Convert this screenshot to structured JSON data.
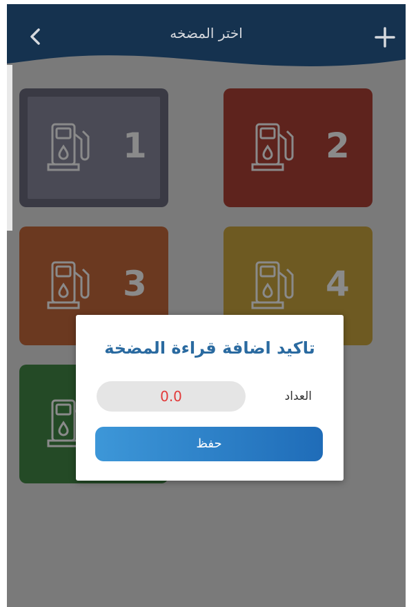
{
  "header": {
    "title": "اختر المضخه",
    "back_icon": "chevron-left-icon",
    "add_icon": "plus-icon"
  },
  "pumps": [
    {
      "number": "1",
      "color": "#3a3a44"
    },
    {
      "number": "2",
      "color": "#5e231d"
    },
    {
      "number": "3",
      "color": "#6b3920"
    },
    {
      "number": "4",
      "color": "#6e5a22"
    },
    {
      "number": "",
      "color": "#244a26"
    }
  ],
  "dialog": {
    "title": "تاكيد اضافة قراءة المضخة",
    "meter_label": "العداد",
    "meter_value": "0.0",
    "save_label": "حفظ"
  },
  "colors": {
    "header": "#15324f",
    "accent": "#2a6aa0",
    "value_text": "#e23a3a"
  }
}
